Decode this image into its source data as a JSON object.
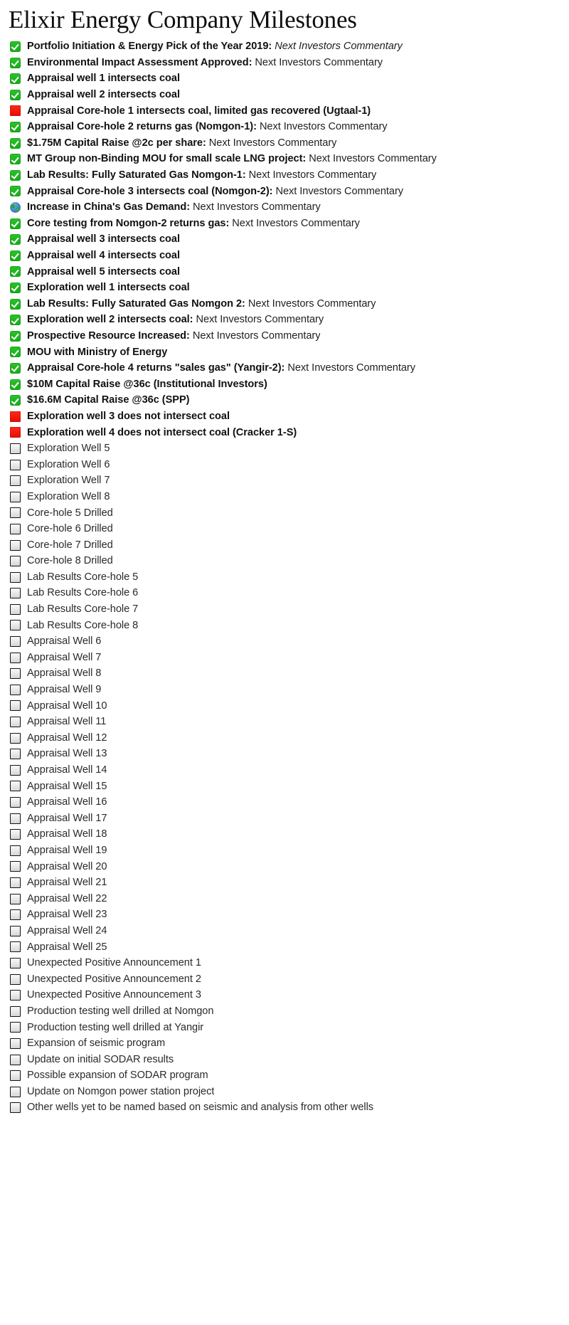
{
  "header": {
    "title": "Elixir Energy Company Milestones"
  },
  "legend": {
    "check_icon": "green-check-icon",
    "cross_icon": "red-square-icon",
    "globe_icon": "globe-icon",
    "empty_icon": "empty-checkbox-icon"
  },
  "colors": {
    "check_green": "#22b222",
    "cross_red": "#f01000",
    "globe_blue": "#3e87c9",
    "empty_box_border": "#111111",
    "text": "#1a1a1a",
    "background": "#ffffff"
  },
  "milestones": [
    {
      "status": "check",
      "lead": "Portfolio Initiation & Energy Pick of the Year 2019:",
      "tail": "Next Investors Commentary",
      "tail_style": "italic"
    },
    {
      "status": "check",
      "lead": "Environmental Impact Assessment Approved:",
      "tail": "Next Investors Commentary",
      "tail_style": "normal"
    },
    {
      "status": "check",
      "lead": "Appraisal well 1 intersects coal",
      "tail": "",
      "tail_style": "normal"
    },
    {
      "status": "check",
      "lead": "Appraisal well 2 intersects coal",
      "tail": "",
      "tail_style": "normal"
    },
    {
      "status": "cross",
      "lead": "Appraisal Core-hole 1 intersects coal, limited gas recovered (Ugtaal-1)",
      "tail": "",
      "tail_style": "normal"
    },
    {
      "status": "check",
      "lead": "Appraisal Core-hole 2 returns gas (Nomgon-1):",
      "tail": "Next Investors Commentary",
      "tail_style": "normal"
    },
    {
      "status": "check",
      "lead": "$1.75M Capital Raise @2c per share:",
      "tail": "Next Investors Commentary",
      "tail_style": "normal"
    },
    {
      "status": "check",
      "lead": "MT Group non-Binding MOU for small scale LNG project:",
      "tail": "Next Investors Commentary",
      "tail_style": "normal"
    },
    {
      "status": "check",
      "lead": "Lab Results: Fully Saturated Gas Nomgon-1:",
      "tail": "Next Investors Commentary",
      "tail_style": "normal"
    },
    {
      "status": "check",
      "lead": "Appraisal Core-hole 3 intersects coal (Nomgon-2):",
      "tail": "Next Investors Commentary",
      "tail_style": "normal"
    },
    {
      "status": "globe",
      "lead": "Increase in China's Gas Demand:",
      "tail": "Next Investors Commentary",
      "tail_style": "normal"
    },
    {
      "status": "check",
      "lead": "Core testing from Nomgon-2 returns gas:",
      "tail": "Next Investors Commentary",
      "tail_style": "normal"
    },
    {
      "status": "check",
      "lead": "Appraisal well 3 intersects coal",
      "tail": "",
      "tail_style": "normal"
    },
    {
      "status": "check",
      "lead": "Appraisal well 4 intersects coal",
      "tail": "",
      "tail_style": "normal"
    },
    {
      "status": "check",
      "lead": "Appraisal well 5 intersects coal",
      "tail": "",
      "tail_style": "normal"
    },
    {
      "status": "check",
      "lead": "Exploration well 1 intersects coal",
      "tail": "",
      "tail_style": "normal"
    },
    {
      "status": "check",
      "lead": "Lab Results: Fully Saturated Gas Nomgon 2:",
      "tail": "Next Investors Commentary",
      "tail_style": "normal"
    },
    {
      "status": "check",
      "lead": "Exploration well 2 intersects coal:",
      "tail": "Next Investors Commentary",
      "tail_style": "normal"
    },
    {
      "status": "check",
      "lead": "Prospective Resource Increased:",
      "tail": "Next Investors Commentary",
      "tail_style": "normal"
    },
    {
      "status": "check",
      "lead": "MOU with Ministry of Energy",
      "tail": "",
      "tail_style": "normal"
    },
    {
      "status": "check",
      "lead": "Appraisal Core-hole 4 returns \"sales gas\" (Yangir-2):",
      "tail": "Next Investors Commentary",
      "tail_style": "normal"
    },
    {
      "status": "check",
      "lead": "$10M Capital Raise @36c (Institutional Investors)",
      "tail": "",
      "tail_style": "normal"
    },
    {
      "status": "check",
      "lead": "$16.6M Capital Raise @36c (SPP)",
      "tail": "",
      "tail_style": "normal"
    },
    {
      "status": "cross",
      "lead": "Exploration well 3 does not intersect coal",
      "tail": "",
      "tail_style": "normal"
    },
    {
      "status": "cross",
      "lead": "Exploration well 4 does not intersect coal (Cracker 1-S)",
      "tail": "",
      "tail_style": "normal"
    },
    {
      "status": "empty",
      "lead": "Exploration Well 5",
      "tail": "",
      "tail_style": "normal"
    },
    {
      "status": "empty",
      "lead": "Exploration Well 6",
      "tail": "",
      "tail_style": "normal"
    },
    {
      "status": "empty",
      "lead": "Exploration Well 7",
      "tail": "",
      "tail_style": "normal"
    },
    {
      "status": "empty",
      "lead": "Exploration Well 8",
      "tail": "",
      "tail_style": "normal"
    },
    {
      "status": "empty",
      "lead": "Core-hole 5 Drilled",
      "tail": "",
      "tail_style": "normal"
    },
    {
      "status": "empty",
      "lead": "Core-hole 6 Drilled",
      "tail": "",
      "tail_style": "normal"
    },
    {
      "status": "empty",
      "lead": "Core-hole 7 Drilled",
      "tail": "",
      "tail_style": "normal"
    },
    {
      "status": "empty",
      "lead": "Core-hole 8 Drilled",
      "tail": "",
      "tail_style": "normal"
    },
    {
      "status": "empty",
      "lead": "Lab Results Core-hole 5",
      "tail": "",
      "tail_style": "normal"
    },
    {
      "status": "empty",
      "lead": "Lab Results Core-hole 6",
      "tail": "",
      "tail_style": "normal"
    },
    {
      "status": "empty",
      "lead": "Lab Results Core-hole 7",
      "tail": "",
      "tail_style": "normal"
    },
    {
      "status": "empty",
      "lead": "Lab Results Core-hole 8",
      "tail": "",
      "tail_style": "normal"
    },
    {
      "status": "empty",
      "lead": "Appraisal Well 6",
      "tail": "",
      "tail_style": "normal"
    },
    {
      "status": "empty",
      "lead": "Appraisal Well 7",
      "tail": "",
      "tail_style": "normal"
    },
    {
      "status": "empty",
      "lead": "Appraisal Well 8",
      "tail": "",
      "tail_style": "normal"
    },
    {
      "status": "empty",
      "lead": "Appraisal Well 9",
      "tail": "",
      "tail_style": "normal"
    },
    {
      "status": "empty",
      "lead": "Appraisal Well 10",
      "tail": "",
      "tail_style": "normal"
    },
    {
      "status": "empty",
      "lead": "Appraisal Well 11",
      "tail": "",
      "tail_style": "normal"
    },
    {
      "status": "empty",
      "lead": "Appraisal Well 12",
      "tail": "",
      "tail_style": "normal"
    },
    {
      "status": "empty",
      "lead": "Appraisal Well 13",
      "tail": "",
      "tail_style": "normal"
    },
    {
      "status": "empty",
      "lead": "Appraisal Well 14",
      "tail": "",
      "tail_style": "normal"
    },
    {
      "status": "empty",
      "lead": "Appraisal Well 15",
      "tail": "",
      "tail_style": "normal"
    },
    {
      "status": "empty",
      "lead": "Appraisal Well 16",
      "tail": "",
      "tail_style": "normal"
    },
    {
      "status": "empty",
      "lead": "Appraisal Well 17",
      "tail": "",
      "tail_style": "normal"
    },
    {
      "status": "empty",
      "lead": "Appraisal Well 18",
      "tail": "",
      "tail_style": "normal"
    },
    {
      "status": "empty",
      "lead": "Appraisal Well 19",
      "tail": "",
      "tail_style": "normal"
    },
    {
      "status": "empty",
      "lead": "Appraisal Well 20",
      "tail": "",
      "tail_style": "normal"
    },
    {
      "status": "empty",
      "lead": "Appraisal Well 21",
      "tail": "",
      "tail_style": "normal"
    },
    {
      "status": "empty",
      "lead": "Appraisal Well 22",
      "tail": "",
      "tail_style": "normal"
    },
    {
      "status": "empty",
      "lead": "Appraisal Well 23",
      "tail": "",
      "tail_style": "normal"
    },
    {
      "status": "empty",
      "lead": "Appraisal Well 24",
      "tail": "",
      "tail_style": "normal"
    },
    {
      "status": "empty",
      "lead": "Appraisal Well 25",
      "tail": "",
      "tail_style": "normal"
    },
    {
      "status": "empty",
      "lead": "Unexpected Positive Announcement 1",
      "tail": "",
      "tail_style": "normal"
    },
    {
      "status": "empty",
      "lead": "Unexpected Positive Announcement 2",
      "tail": "",
      "tail_style": "normal"
    },
    {
      "status": "empty",
      "lead": "Unexpected Positive Announcement 3",
      "tail": "",
      "tail_style": "normal"
    },
    {
      "status": "empty",
      "lead": "Production testing well drilled at Nomgon",
      "tail": "",
      "tail_style": "normal"
    },
    {
      "status": "empty",
      "lead": "Production testing well drilled at Yangir",
      "tail": "",
      "tail_style": "normal"
    },
    {
      "status": "empty",
      "lead": "Expansion of seismic program",
      "tail": "",
      "tail_style": "normal"
    },
    {
      "status": "empty",
      "lead": "Update on initial SODAR results",
      "tail": "",
      "tail_style": "normal"
    },
    {
      "status": "empty",
      "lead": "Possible expansion of SODAR program",
      "tail": "",
      "tail_style": "normal"
    },
    {
      "status": "empty",
      "lead": "Update on Nomgon power station project",
      "tail": "",
      "tail_style": "normal"
    },
    {
      "status": "empty",
      "lead": "Other wells yet to be named based on seismic and analysis from other wells",
      "tail": "",
      "tail_style": "normal"
    }
  ]
}
